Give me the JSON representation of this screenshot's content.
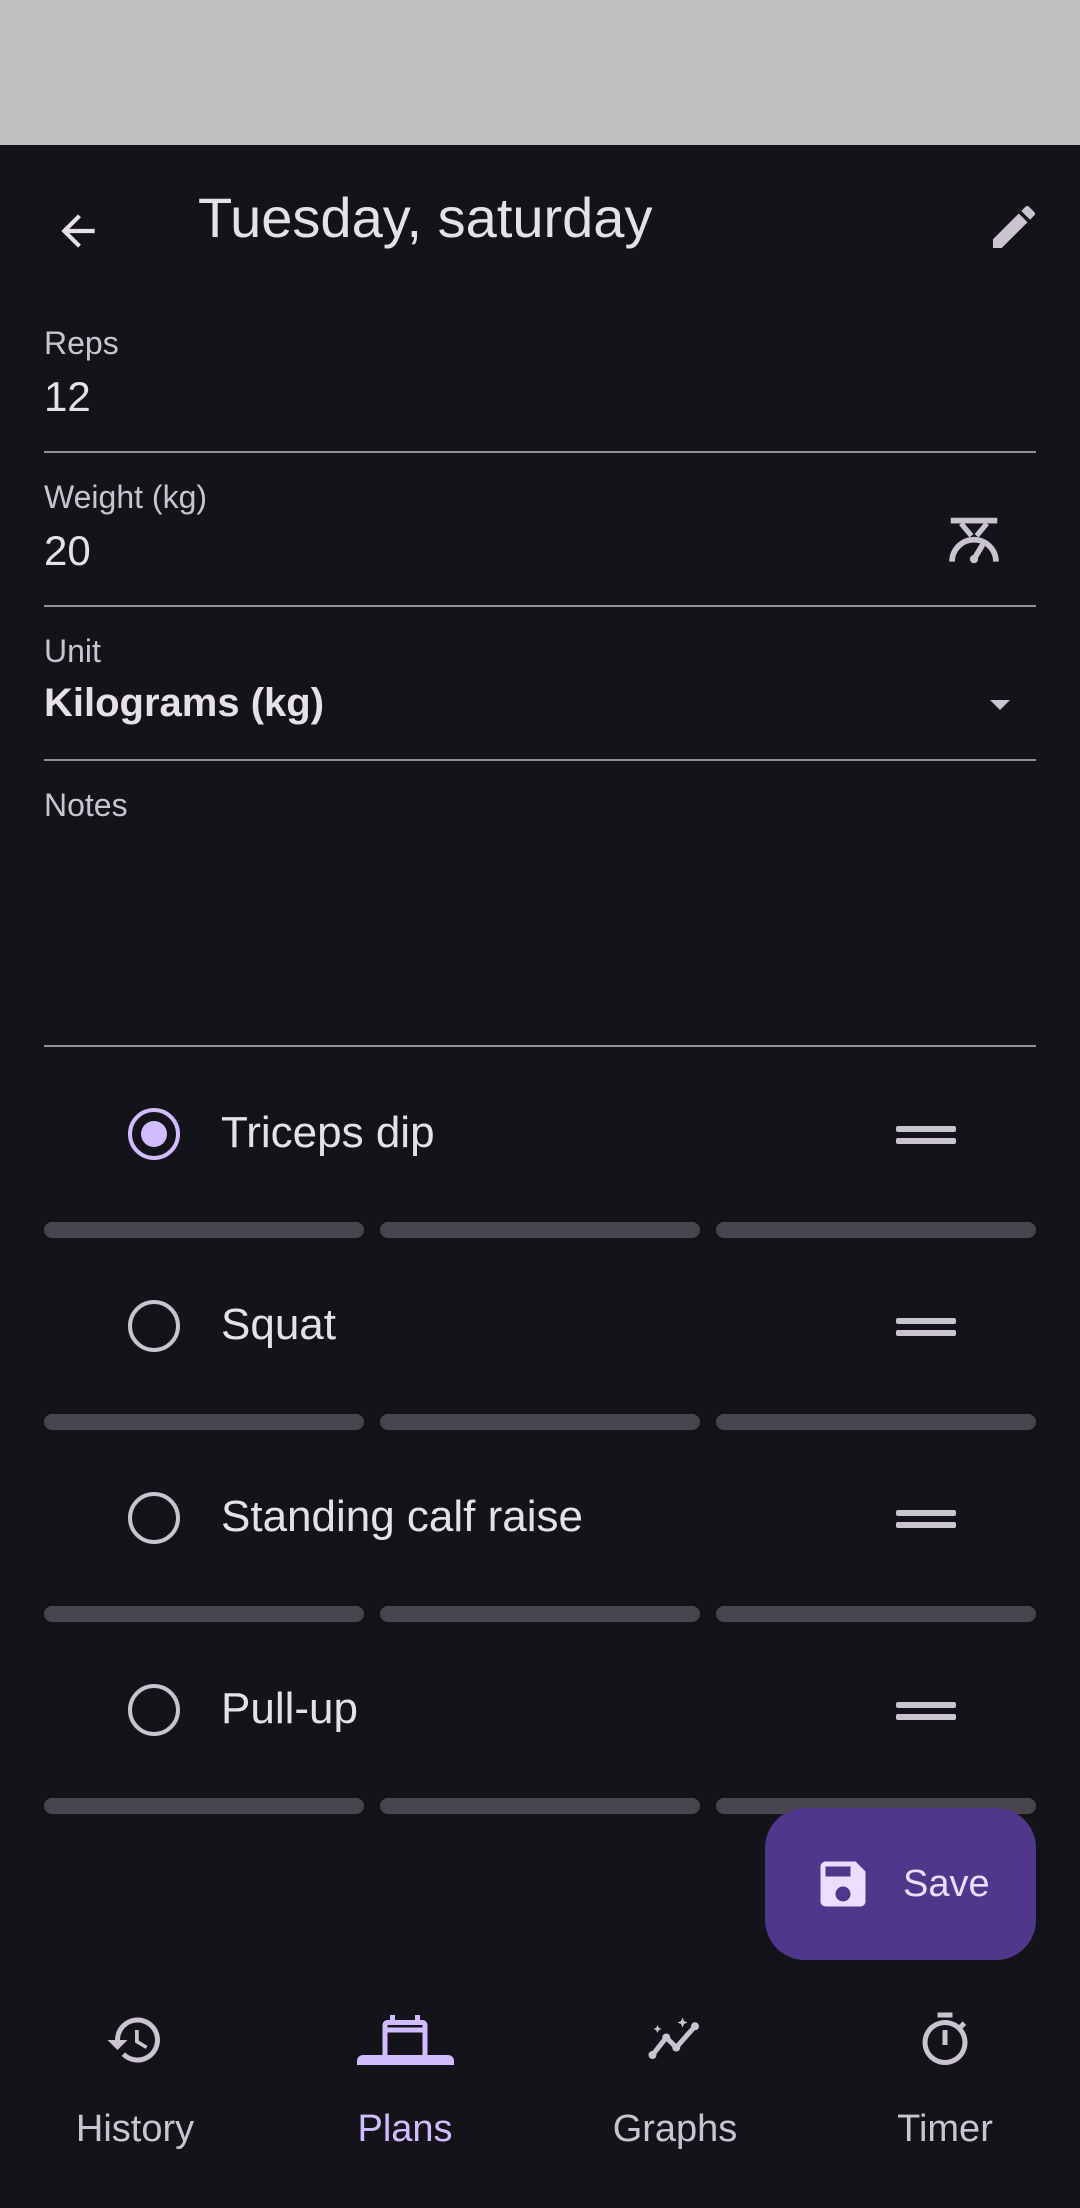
{
  "topbar": {
    "title": "Tuesday, saturday",
    "back_icon": "arrow-back-icon",
    "edit_icon": "pencil-icon"
  },
  "form": {
    "reps": {
      "label": "Reps",
      "value": "12"
    },
    "weight": {
      "label": "Weight (kg)",
      "value": "20",
      "icon": "scale-icon"
    },
    "unit": {
      "label": "Unit",
      "value": "Kilograms (kg)",
      "icon": "dropdown-arrow-icon"
    },
    "notes": {
      "label": "Notes",
      "value": ""
    }
  },
  "exercises": [
    {
      "name": "Triceps dip",
      "selected": true
    },
    {
      "name": "Squat",
      "selected": false
    },
    {
      "name": "Standing calf raise",
      "selected": false
    },
    {
      "name": "Pull-up",
      "selected": false
    }
  ],
  "fab": {
    "label": "Save",
    "icon": "save-icon"
  },
  "nav": {
    "items": [
      {
        "label": "History",
        "icon": "history-icon"
      },
      {
        "label": "Plans",
        "icon": "calendar-icon"
      },
      {
        "label": "Graphs",
        "icon": "graph-icon"
      },
      {
        "label": "Timer",
        "icon": "timer-icon"
      }
    ],
    "active": "Plans"
  },
  "colors": {
    "background": "#15131a",
    "accent": "#d0bcff",
    "fab": "#4f378b",
    "divider": "#938f99",
    "segment": "#49454f"
  }
}
